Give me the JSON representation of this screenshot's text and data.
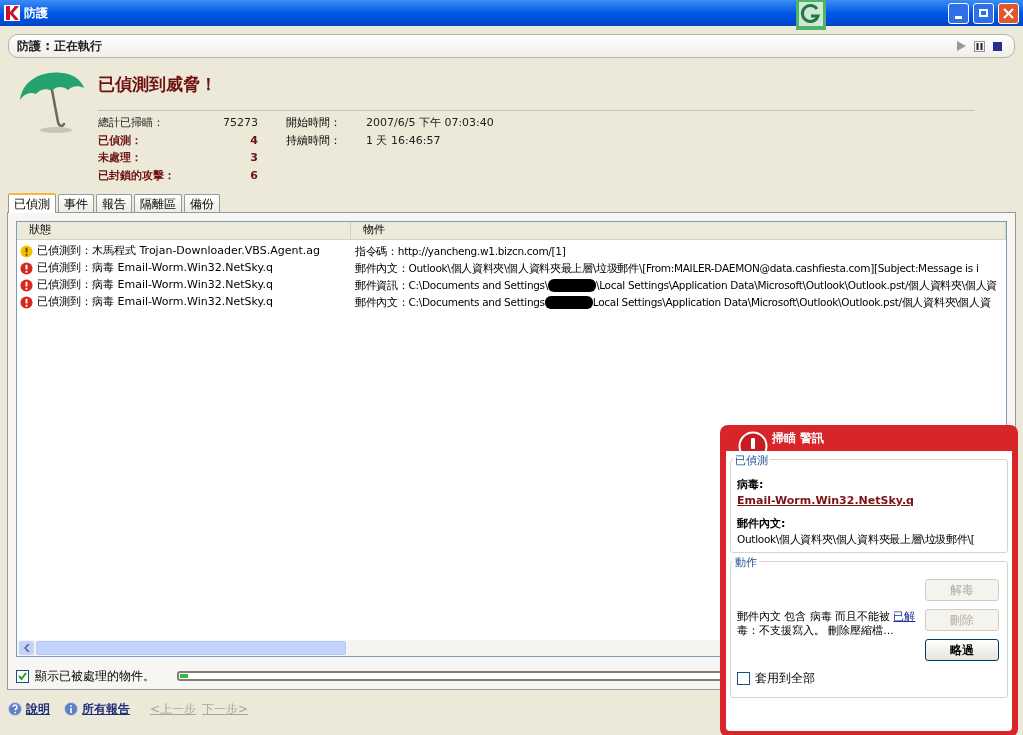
{
  "window": {
    "title": "防護"
  },
  "status_bar": {
    "text": "防護 : 正在執行"
  },
  "header": {
    "title": "已偵測到威脅！",
    "stats": [
      {
        "label": "總計已掃瞄：",
        "value": "75273",
        "alert": false
      },
      {
        "label": "已偵測：",
        "value": "4",
        "alert": true
      },
      {
        "label": "未處理：",
        "value": "3",
        "alert": true
      },
      {
        "label": "已封鎖的攻擊：",
        "value": "6",
        "alert": true
      }
    ],
    "times": [
      {
        "label": "開始時間：",
        "value": "2007/6/5 下午 07:03:40"
      },
      {
        "label": "持續時間：",
        "value": "1 天 16:46:57"
      }
    ]
  },
  "tabs": [
    {
      "label": "已偵測",
      "selected": true
    },
    {
      "label": "事件",
      "selected": false
    },
    {
      "label": "報告",
      "selected": false
    },
    {
      "label": "隔離區",
      "selected": false
    },
    {
      "label": "備份",
      "selected": false
    }
  ],
  "table": {
    "columns": [
      "狀態",
      "物件"
    ],
    "rows": [
      {
        "kind": "warning",
        "status": "已偵測到：木馬程式 Trojan-Downloader.VBS.Agent.ag",
        "object": "指令碼：http://yancheng.w1.bizcn.com/[1]"
      },
      {
        "kind": "critical",
        "status": "已偵測到：病毒 Email-Worm.Win32.NetSky.q",
        "object": "郵件內文：Outlook\\個人資料夾\\個人資料夾最上層\\垃圾郵件\\[From:MAILER-DAEMON@data.cashfiesta.com][Subject:Message is i"
      },
      {
        "kind": "critical",
        "status": "已偵測到：病毒 Email-Worm.Win32.NetSky.q",
        "object": "郵件資訊：C:\\Documents and Settings\\",
        "object_rest": "\\Local Settings\\Application Data\\Microsoft\\Outlook\\Outlook.pst/個人資料夾\\個人資"
      },
      {
        "kind": "critical",
        "status": "已偵測到：病毒 Email-Worm.Win32.NetSky.q",
        "object": "郵件內文：C:\\Documents and Settings",
        "object_rest": "Local Settings\\Application Data\\Microsoft\\Outlook\\Outlook.pst/個人資料夾\\個人資"
      }
    ]
  },
  "show_processed": {
    "label": "顯示已被處理的物件。",
    "checked": true
  },
  "progress": {
    "level": 0.01
  },
  "footer": {
    "links": [
      {
        "label": "說明",
        "kind": "help"
      },
      {
        "label": "所有報告",
        "kind": "info"
      }
    ],
    "nav": [
      {
        "label": "<上一步",
        "disabled": true
      },
      {
        "label": "下一步>",
        "disabled": true
      }
    ]
  },
  "alert": {
    "title": "掃瞄 警訊",
    "detected_legend": "已偵測",
    "threat_label": "病毒:",
    "threat_name": "Email-Worm.Win32.NetSky.q",
    "object_label": "郵件內文:",
    "object_path": "Outlook\\個人資料夾\\個人資料夾最上層\\垃圾郵件\\[",
    "action_legend": "動作",
    "message_before": "郵件內文 包含 病毒 而且不能被 ",
    "message_link": "已解",
    "message_after": "毒：不支援寫入。 刪除壓縮檔…",
    "buttons": [
      {
        "label": "解毒",
        "disabled": true
      },
      {
        "label": "刪除",
        "disabled": true
      },
      {
        "label": "略過",
        "disabled": false
      }
    ],
    "apply_all": {
      "label": "套用到全部",
      "checked": false
    }
  }
}
